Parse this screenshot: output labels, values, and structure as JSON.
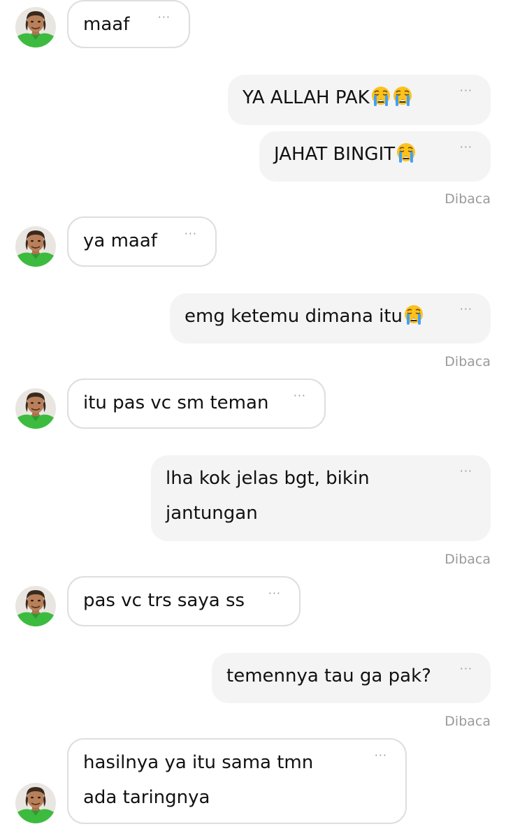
{
  "messages": [
    {
      "side": "in",
      "text": "maaf"
    },
    {
      "side": "out",
      "text": "YA ALLAH PAK",
      "emoji": "crying-face-emoji",
      "emoji_count": 2
    },
    {
      "side": "out",
      "text": "JAHAT BINGIT",
      "emoji": "crying-face-emoji",
      "emoji_count": 1
    },
    {
      "side": "in",
      "text": "ya maaf"
    },
    {
      "side": "out",
      "text": "emg ketemu dimana itu",
      "emoji": "crying-face-emoji",
      "emoji_count": 1
    },
    {
      "side": "in",
      "text": "itu pas vc sm teman"
    },
    {
      "side": "out",
      "line1": "lha kok jelas bgt, bikin",
      "line2": "jantungan"
    },
    {
      "side": "in",
      "text": "pas vc trs saya ss"
    },
    {
      "side": "out",
      "text": "temennya tau ga pak?"
    },
    {
      "side": "in",
      "line1": "hasilnya ya itu sama tmn",
      "line2": "ada taringnya"
    }
  ],
  "read_receipt": "Dibaca",
  "menu_dots": "···",
  "icons": {
    "message_menu": "more-dots-icon",
    "avatar": "contact-avatar",
    "emoji": "crying-face-emoji"
  },
  "colors": {
    "incoming_bubble": "#ffffff",
    "incoming_border": "#dedede",
    "outgoing_bubble": "#f4f4f4",
    "meta_text": "#9a9a9a",
    "avatar_shirt": "#3dbb3f"
  }
}
